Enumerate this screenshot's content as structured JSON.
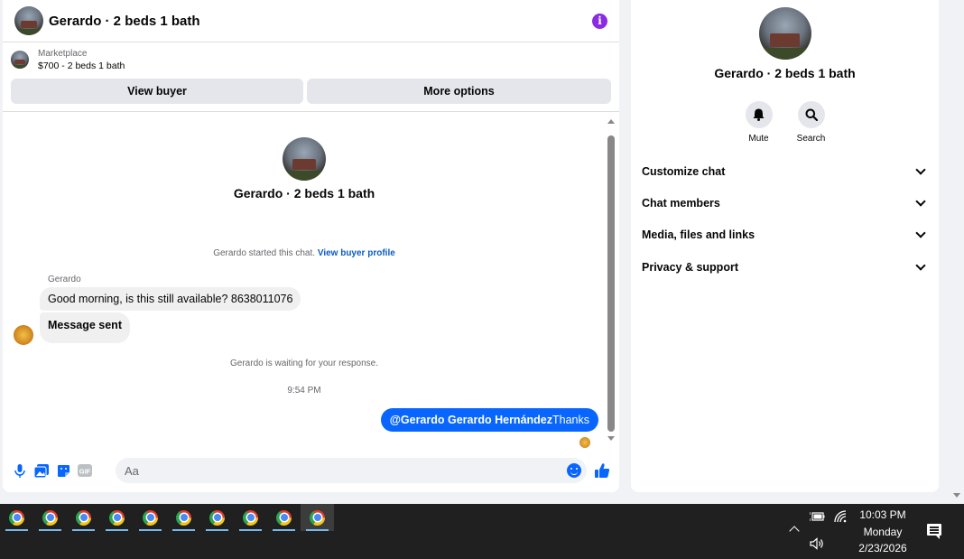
{
  "chat": {
    "header_title": "Gerardo · 2 beds 1 bath",
    "marketplace_label": "Marketplace",
    "listing": "$700 - 2 beds 1 bath",
    "view_buyer_label": "View buyer",
    "more_options_label": "More options",
    "convo_title": "Gerardo · 2 beds 1 bath",
    "started_text": "Gerardo started this chat.",
    "view_buyer_profile_link": "View buyer profile",
    "sender_name": "Gerardo",
    "messages": [
      {
        "text": "Good morning, is this still available? 8638011076"
      },
      {
        "text": "Message sent"
      }
    ],
    "waiting_text": "Gerardo is waiting for your response.",
    "timestamp": "9:54 PM",
    "outgoing_mention": "@Gerardo Gerardo Hernández",
    "outgoing_text": "Thanks",
    "composer_placeholder": "Aa"
  },
  "details": {
    "title": "Gerardo · 2 beds 1 bath",
    "mute_label": "Mute",
    "search_label": "Search",
    "sections": [
      {
        "label": "Customize chat"
      },
      {
        "label": "Chat members"
      },
      {
        "label": "Media, files and links"
      },
      {
        "label": "Privacy & support"
      }
    ]
  },
  "taskbar": {
    "app_count": 10,
    "time": "10:03 PM",
    "day": "Monday",
    "date": "2/23/2026"
  },
  "colors": {
    "accent": "#0866ff",
    "info": "#8a2be2",
    "taskbar": "#202020"
  }
}
